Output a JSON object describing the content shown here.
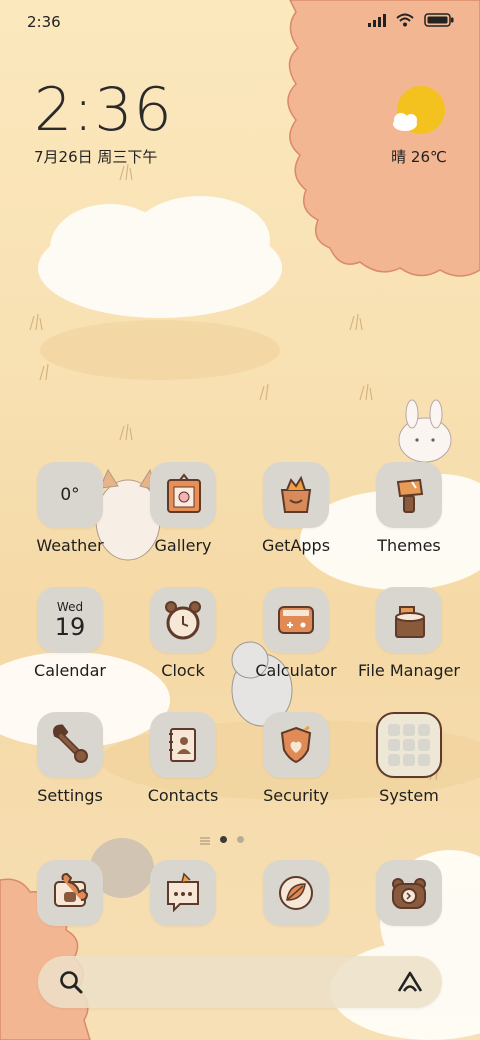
{
  "status_bar": {
    "time": "2:36",
    "icons": [
      "signal-icon",
      "wifi-icon",
      "battery-icon"
    ]
  },
  "clock_widget": {
    "time": "2:36",
    "date": "7月26日 周三下午"
  },
  "weather_widget": {
    "condition_icon": "sun-cloud-icon",
    "text": "晴 26℃"
  },
  "apps": {
    "row1": [
      {
        "label": "Weather",
        "tile_text": "0°"
      },
      {
        "label": "Gallery"
      },
      {
        "label": "GetApps"
      },
      {
        "label": "Themes"
      }
    ],
    "row2": [
      {
        "label": "Calendar",
        "day_name": "Wed",
        "day_num": "19"
      },
      {
        "label": "Clock"
      },
      {
        "label": "Calculator"
      },
      {
        "label": "File Manager"
      }
    ],
    "row3": [
      {
        "label": "Settings"
      },
      {
        "label": "Contacts"
      },
      {
        "label": "Security"
      },
      {
        "label": "System"
      }
    ]
  },
  "page_indicator": {
    "pages": 2,
    "current": 1
  },
  "dock": [
    "phone-icon",
    "messages-icon",
    "browser-icon",
    "camera-icon"
  ],
  "search_bar": {
    "left_icon": "search-icon",
    "right_icon": "assistant-icon"
  },
  "colors": {
    "tile": "#d9d6cf",
    "accent_brown": "#8a5a3c",
    "accent_orange": "#e88c4e",
    "sun": "#f4c21f"
  }
}
